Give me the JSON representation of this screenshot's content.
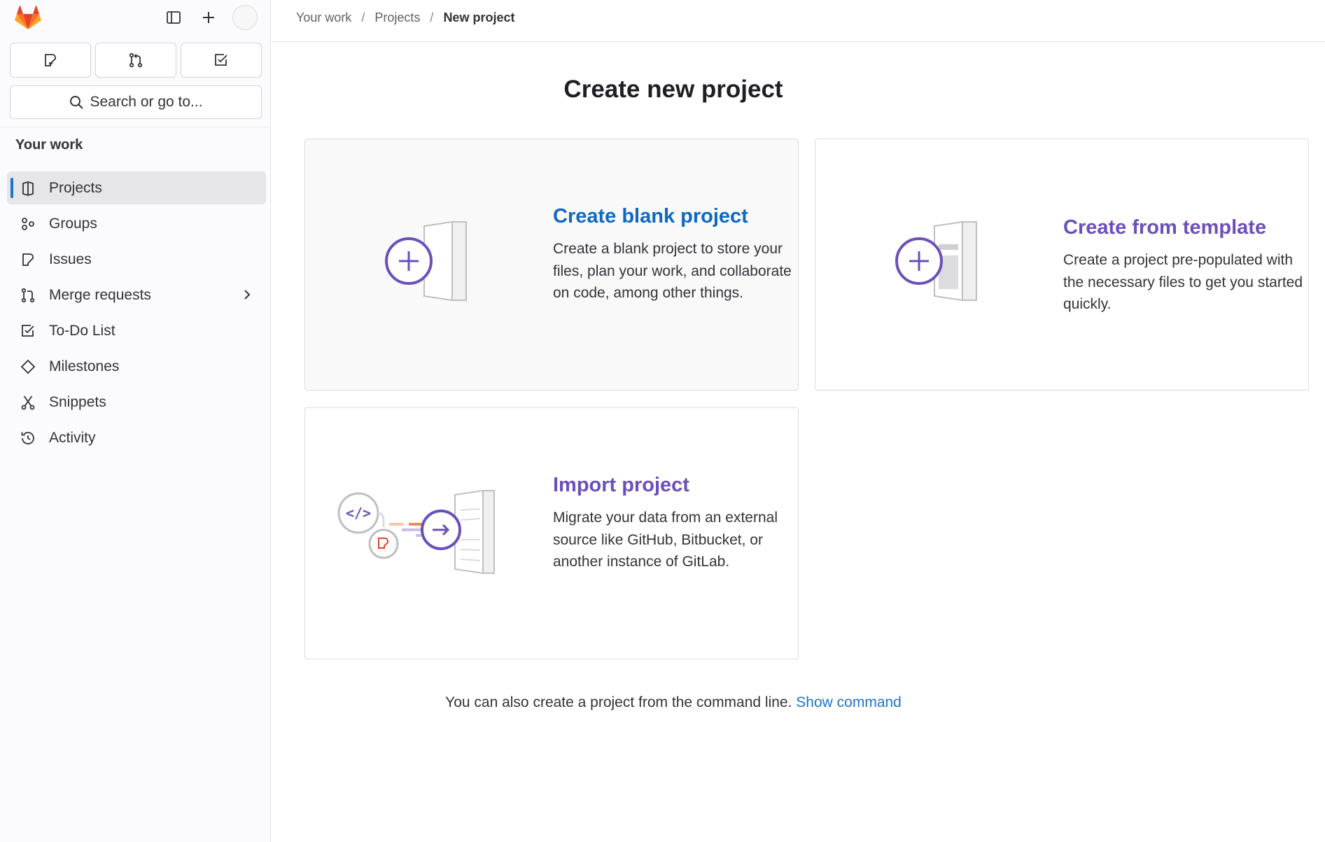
{
  "sidebar": {
    "search_label": "Search or go to...",
    "section_title": "Your work",
    "items": [
      {
        "label": "Projects",
        "icon": "project-icon",
        "active": true
      },
      {
        "label": "Groups",
        "icon": "group-icon"
      },
      {
        "label": "Issues",
        "icon": "issues-icon"
      },
      {
        "label": "Merge requests",
        "icon": "merge-request-icon",
        "has_chevron": true
      },
      {
        "label": "To-Do List",
        "icon": "todo-icon"
      },
      {
        "label": "Milestones",
        "icon": "milestone-icon"
      },
      {
        "label": "Snippets",
        "icon": "snippet-icon"
      },
      {
        "label": "Activity",
        "icon": "history-icon"
      }
    ]
  },
  "breadcrumb": {
    "items": [
      "Your work",
      "Projects",
      "New project"
    ]
  },
  "main": {
    "title": "Create new project",
    "cards": {
      "blank": {
        "title": "Create blank project",
        "description": "Create a blank project to store your files, plan your work, and collaborate on code, among other things."
      },
      "template": {
        "title": "Create from template",
        "description": "Create a project pre-populated with the necessary files to get you started quickly."
      },
      "import": {
        "title": "Import project",
        "description": "Migrate your data from an external source like GitHub, Bitbucket, or another instance of GitLab."
      }
    },
    "cli_text": "You can also create a project from the command line.",
    "cli_link": "Show command"
  },
  "colors": {
    "link_blue": "#1f75cb",
    "title_blue": "#1068bf",
    "title_purple": "#6b4fbb",
    "active_indicator": "#1f75cb"
  }
}
